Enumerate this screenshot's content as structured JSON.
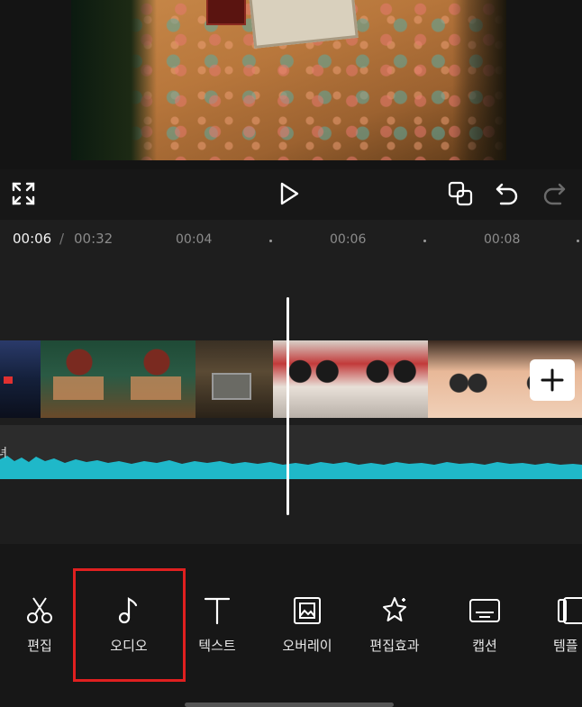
{
  "timecode": {
    "current": "00:06",
    "separator": "/",
    "total": "00:32"
  },
  "ruler": {
    "ticks": [
      "00:04",
      "00:06",
      "00:08"
    ]
  },
  "audio_track": {
    "label": "녀"
  },
  "toolbar": {
    "items": [
      {
        "label": "편집",
        "icon": "scissors-icon"
      },
      {
        "label": "오디오",
        "icon": "music-note-icon"
      },
      {
        "label": "텍스트",
        "icon": "text-icon"
      },
      {
        "label": "오버레이",
        "icon": "overlay-icon"
      },
      {
        "label": "편집효과",
        "icon": "sparkle-icon"
      },
      {
        "label": "캡션",
        "icon": "caption-icon"
      },
      {
        "label": "템플",
        "icon": "template-icon"
      }
    ]
  },
  "colors": {
    "waveform": "#1fb8c9",
    "highlight": "#e02020",
    "background": "#171717"
  }
}
